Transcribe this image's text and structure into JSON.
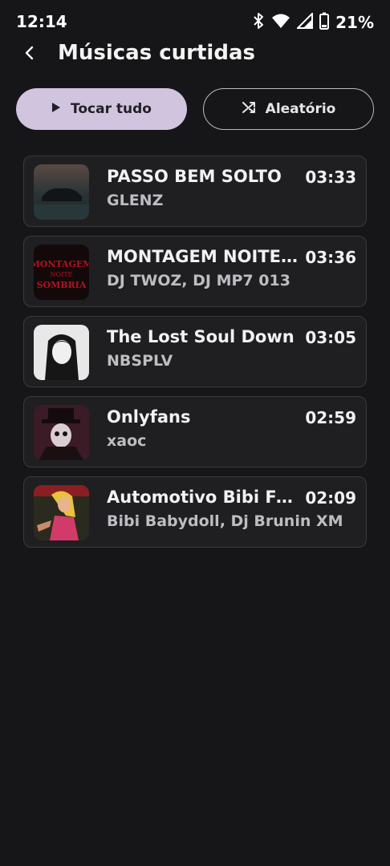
{
  "status_bar": {
    "time": "12:14",
    "battery": "21%",
    "icons": [
      "bluetooth-icon",
      "wifi-icon",
      "signal-icon",
      "battery-icon"
    ]
  },
  "header": {
    "back_icon": "chevron-left-icon",
    "title": "Músicas curtidas"
  },
  "actions": {
    "play_all_label": "Tocar tudo",
    "play_all_icon": "play-icon",
    "shuffle_label": "Aleatório",
    "shuffle_icon": "shuffle-icon"
  },
  "tracks": [
    {
      "title": "PASSO BEM SOLTO",
      "artist": "GLENZ",
      "duration": "03:33"
    },
    {
      "title": "MONTAGEM NOITE SOMBRIA",
      "artist": "DJ TWOZ, DJ MP7 013",
      "duration": "03:36",
      "cover_text": [
        "MONTAGEM",
        "NOITE",
        "SOMBRIA"
      ]
    },
    {
      "title": "The Lost Soul Down",
      "artist": "NBSPLV",
      "duration": "03:05"
    },
    {
      "title": "Onlyfans",
      "artist": "xaoc",
      "duration": "02:59"
    },
    {
      "title": "Automotivo Bibi Fogosa",
      "artist": "Bibi Babydoll, Dj Brunin XM",
      "duration": "02:09"
    }
  ],
  "colors": {
    "background": "#161618",
    "accent": "#d1c4df",
    "card": "#1f1f22"
  }
}
